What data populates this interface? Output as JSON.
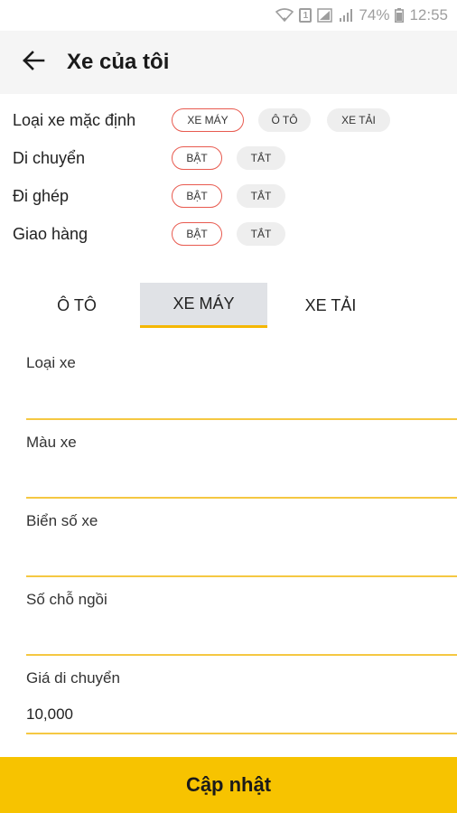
{
  "status_bar": {
    "wifi_icon": "wifi-icon",
    "sim_label": "1",
    "battery_pct": "74%",
    "time": "12:55"
  },
  "app_bar": {
    "back_icon": "arrow-left-icon",
    "title": "Xe của tôi"
  },
  "settings": {
    "default_vehicle": {
      "label": "Loại xe mặc định",
      "options": [
        "XE MÁY",
        "Ô TÔ",
        "XE TẢI"
      ],
      "selected": "XE MÁY"
    },
    "move": {
      "label": "Di chuyển",
      "on": "BẬT",
      "off": "TẮT",
      "selected": "BẬT"
    },
    "ride_share": {
      "label": "Đi ghép",
      "on": "BẬT",
      "off": "TẮT",
      "selected": "BẬT"
    },
    "delivery": {
      "label": "Giao hàng",
      "on": "BẬT",
      "off": "TẮT",
      "selected": "BẬT"
    }
  },
  "tabs": [
    {
      "label": "Ô TÔ",
      "active": false
    },
    {
      "label": "XE MÁY",
      "active": true
    },
    {
      "label": "XE TẢI",
      "active": false
    }
  ],
  "form": {
    "vehicle_type": {
      "label": "Loại xe",
      "value": ""
    },
    "vehicle_color": {
      "label": "Màu xe",
      "value": ""
    },
    "plate_number": {
      "label": "Biển số xe",
      "value": ""
    },
    "seat_count": {
      "label": "Số chỗ ngồi",
      "value": ""
    },
    "travel_price": {
      "label": "Giá di chuyển",
      "value": "10,000"
    }
  },
  "update_button": {
    "label": "Cập nhật"
  },
  "colors": {
    "accent": "#f7c300",
    "selected_chip_border": "#e85a4f",
    "field_underline": "#f5c842"
  }
}
